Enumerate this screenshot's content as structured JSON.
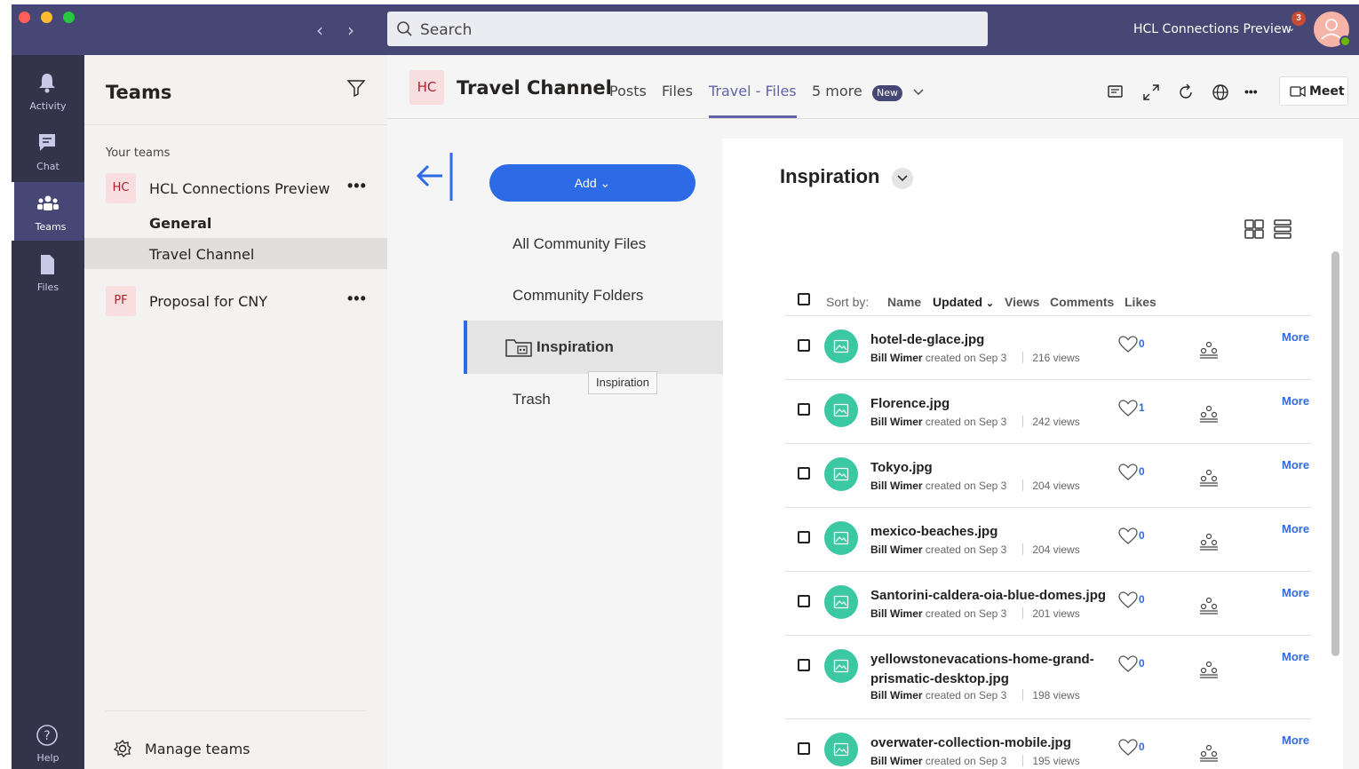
{
  "titlebar": {
    "search_placeholder": "Search",
    "tenant": "HCL Connections Preview",
    "notification_count": "3"
  },
  "rail": [
    {
      "label": "Activity",
      "icon": "bell-icon"
    },
    {
      "label": "Chat",
      "icon": "chat-icon"
    },
    {
      "label": "Teams",
      "icon": "teams-icon",
      "active": true
    },
    {
      "label": "Files",
      "icon": "file-icon"
    },
    {
      "label": "Help",
      "icon": "help-icon"
    }
  ],
  "teams_panel": {
    "title": "Teams",
    "section_label": "Your teams",
    "teams": [
      {
        "initials": "HC",
        "name": "HCL Connections Preview",
        "more": "•••"
      },
      {
        "initials": "PF",
        "name": "Proposal for CNY",
        "more": "•••"
      }
    ],
    "channels": [
      "General",
      "Travel Channel"
    ],
    "manage_label": "Manage teams"
  },
  "channel_header": {
    "initials": "HC",
    "title": "Travel Channel",
    "tabs": [
      "Posts",
      "Files",
      "Travel - Files",
      "5 more"
    ],
    "active_tab": "Travel - Files",
    "new_badge": "New",
    "meet_label": "Meet",
    "more_dots": "•••"
  },
  "files_nav": {
    "add_label": "Add",
    "links": [
      "All Community Files",
      "Community Folders",
      "Inspiration",
      "Trash"
    ],
    "selected": "Inspiration",
    "tooltip": "Inspiration"
  },
  "files_panel": {
    "folder_title": "Inspiration",
    "sort": {
      "label": "Sort by:",
      "options": [
        "Name",
        "Updated",
        "Views",
        "Comments",
        "Likes"
      ],
      "active": "Updated"
    },
    "files": [
      {
        "name": "hotel-de-glace.jpg",
        "author": "Bill Wimer",
        "created": "created on Sep 3",
        "views": "216 views",
        "likes": "0",
        "more": "More"
      },
      {
        "name": "Florence.jpg",
        "author": "Bill Wimer",
        "created": "created on Sep 3",
        "views": "242 views",
        "likes": "1",
        "more": "More"
      },
      {
        "name": "Tokyo.jpg",
        "author": "Bill Wimer",
        "created": "created on Sep 3",
        "views": "204 views",
        "likes": "0",
        "more": "More"
      },
      {
        "name": "mexico-beaches.jpg",
        "author": "Bill Wimer",
        "created": "created on Sep 3",
        "views": "204 views",
        "likes": "0",
        "more": "More"
      },
      {
        "name": "Santorini-caldera-oia-blue-domes.jpg",
        "author": "Bill Wimer",
        "created": "created on Sep 3",
        "views": "201 views",
        "likes": "0",
        "more": "More"
      },
      {
        "name": "yellowstonevacations-home-grand-prismatic-desktop.jpg",
        "author": "Bill Wimer",
        "created": "created on Sep 3",
        "views": "198 views",
        "likes": "0",
        "more": "More"
      },
      {
        "name": "overwater-collection-mobile.jpg",
        "author": "Bill Wimer",
        "created": "created on Sep 3",
        "views": "195 views",
        "likes": "0",
        "more": "More"
      }
    ]
  },
  "colors": {
    "titlebar": "#464775",
    "rail": "#33344a",
    "accent": "#6264a7",
    "link_blue": "#2c6be5",
    "file_icon": "#3dc8a4"
  }
}
